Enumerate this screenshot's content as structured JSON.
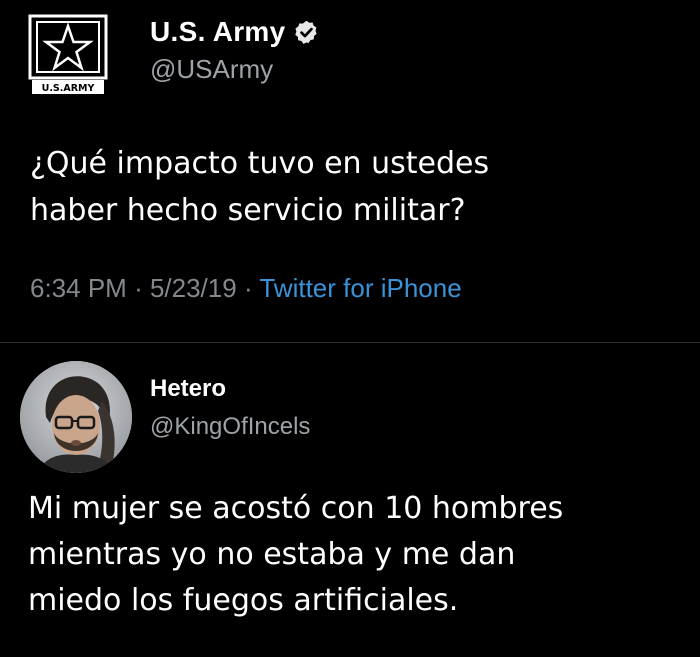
{
  "tweet": {
    "author": {
      "name": "U.S. Army",
      "handle": "@USArmy",
      "logo_caption": "U.S.ARMY",
      "verified_icon": "verified-badge-icon"
    },
    "text_lines": [
      "¿Qué impacto tuvo en ustedes",
      "haber hecho servicio militar?"
    ],
    "time": "6:34 PM",
    "separator": "·",
    "date": "5/23/19",
    "source": "Twitter for iPhone"
  },
  "reply": {
    "author": {
      "name": "Hetero",
      "handle": "@KingOfIncels"
    },
    "text_lines": [
      "Mi mujer se acostó con 10 hombres",
      "mientras yo no estaba y me dan",
      "miedo los fuegos artificiales."
    ]
  },
  "colors": {
    "background": "#000000",
    "primary_text": "#ffffff",
    "secondary_text": "#9ea3a8",
    "link": "#3a92d8",
    "divider": "#2a2d31"
  }
}
